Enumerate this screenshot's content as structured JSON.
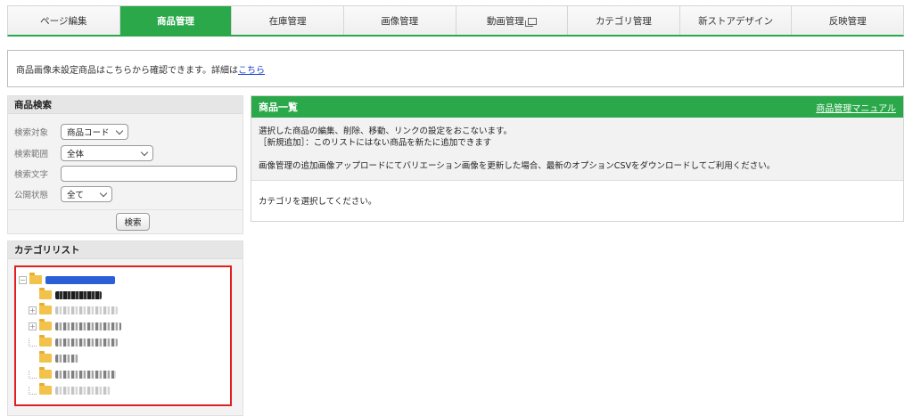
{
  "tabs": [
    {
      "label": "ページ編集",
      "active": false
    },
    {
      "label": "商品管理",
      "active": true
    },
    {
      "label": "在庫管理",
      "active": false
    },
    {
      "label": "画像管理",
      "active": false
    },
    {
      "label": "動画管理",
      "active": false,
      "icon": "external-window-icon"
    },
    {
      "label": "カテゴリ管理",
      "active": false
    },
    {
      "label": "新ストアデザイン",
      "active": false
    },
    {
      "label": "反映管理",
      "active": false
    }
  ],
  "notice": {
    "text": "商品画像未設定商品はこちらから確認できます。詳細は",
    "link": "こちら"
  },
  "search": {
    "title": "商品検索",
    "target_label": "検索対象",
    "target_value": "商品コード",
    "range_label": "検索範囲",
    "range_value": "全体",
    "text_label": "検索文字",
    "text_value": "",
    "status_label": "公開状態",
    "status_value": "全て",
    "button": "検索"
  },
  "category": {
    "title": "カテゴリリスト",
    "highlight_color": "#e02020"
  },
  "product_list": {
    "title": "商品一覧",
    "manual_link": "商品管理マニュアル",
    "desc_line1": "選択した商品の編集、削除、移動、リンクの設定をおこないます。",
    "desc_line2": "［新規追加］：このリストにはない商品を新たに追加できます",
    "desc_line3": "画像管理の追加画像アップロードにてバリエーション画像を更新した場合、最新のオプションCSVをダウンロードしてご利用ください。",
    "empty_message": "カテゴリを選択してください。"
  },
  "colors": {
    "accent_green": "#2aa84a",
    "link_blue": "#1a3ecf"
  }
}
